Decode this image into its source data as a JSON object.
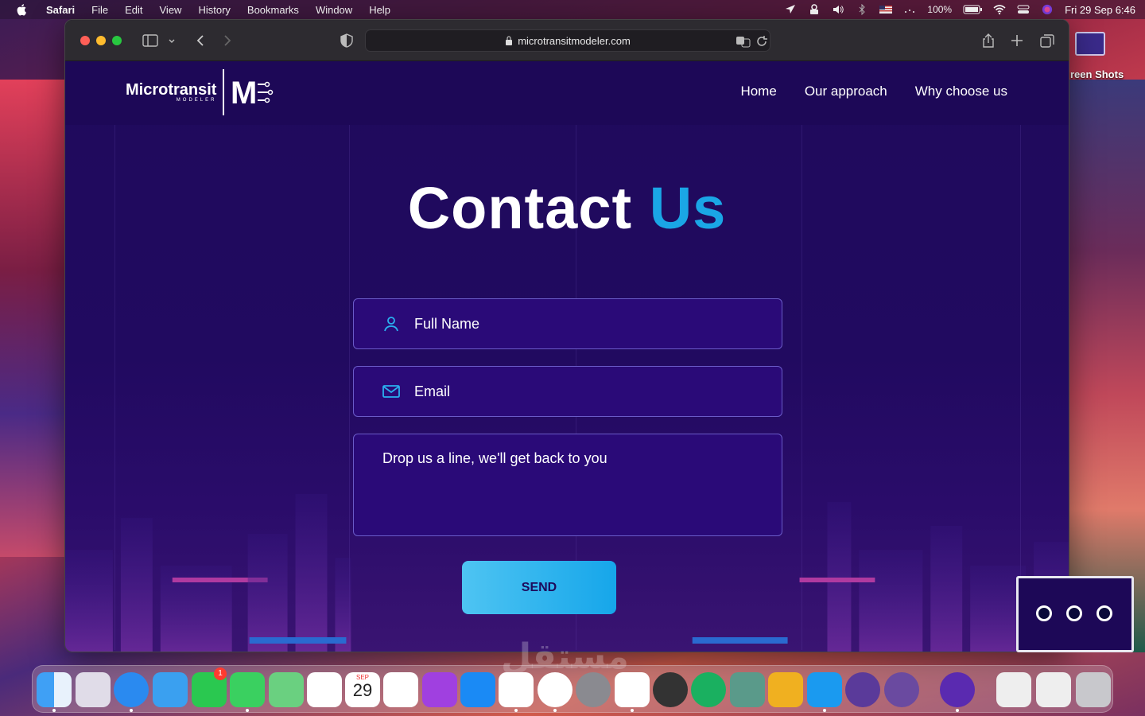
{
  "menubar": {
    "app": "Safari",
    "items": [
      "File",
      "Edit",
      "View",
      "History",
      "Bookmarks",
      "Window",
      "Help"
    ],
    "battery": "100%",
    "datetime": "Fri 29 Sep  6:46"
  },
  "browser": {
    "url": "microtransitmodeler.com"
  },
  "site": {
    "logo_text": "Microtransit",
    "logo_sub": "MODELER",
    "logo_mark": "M",
    "nav": [
      "Home",
      "Our approach",
      "Why choose us"
    ],
    "title_main": "Contact",
    "title_accent": "Us",
    "full_name_placeholder": "Full Name",
    "email_placeholder": "Email",
    "message_placeholder": "Drop us a line, we'll get back to you",
    "send_label": "SEND"
  },
  "desktop": {
    "folder_label": "reen Shots"
  },
  "dock": {
    "facetime_badge": "1",
    "calendar_month": "SEP",
    "calendar_day": "29"
  },
  "watermark": "مستقل"
}
